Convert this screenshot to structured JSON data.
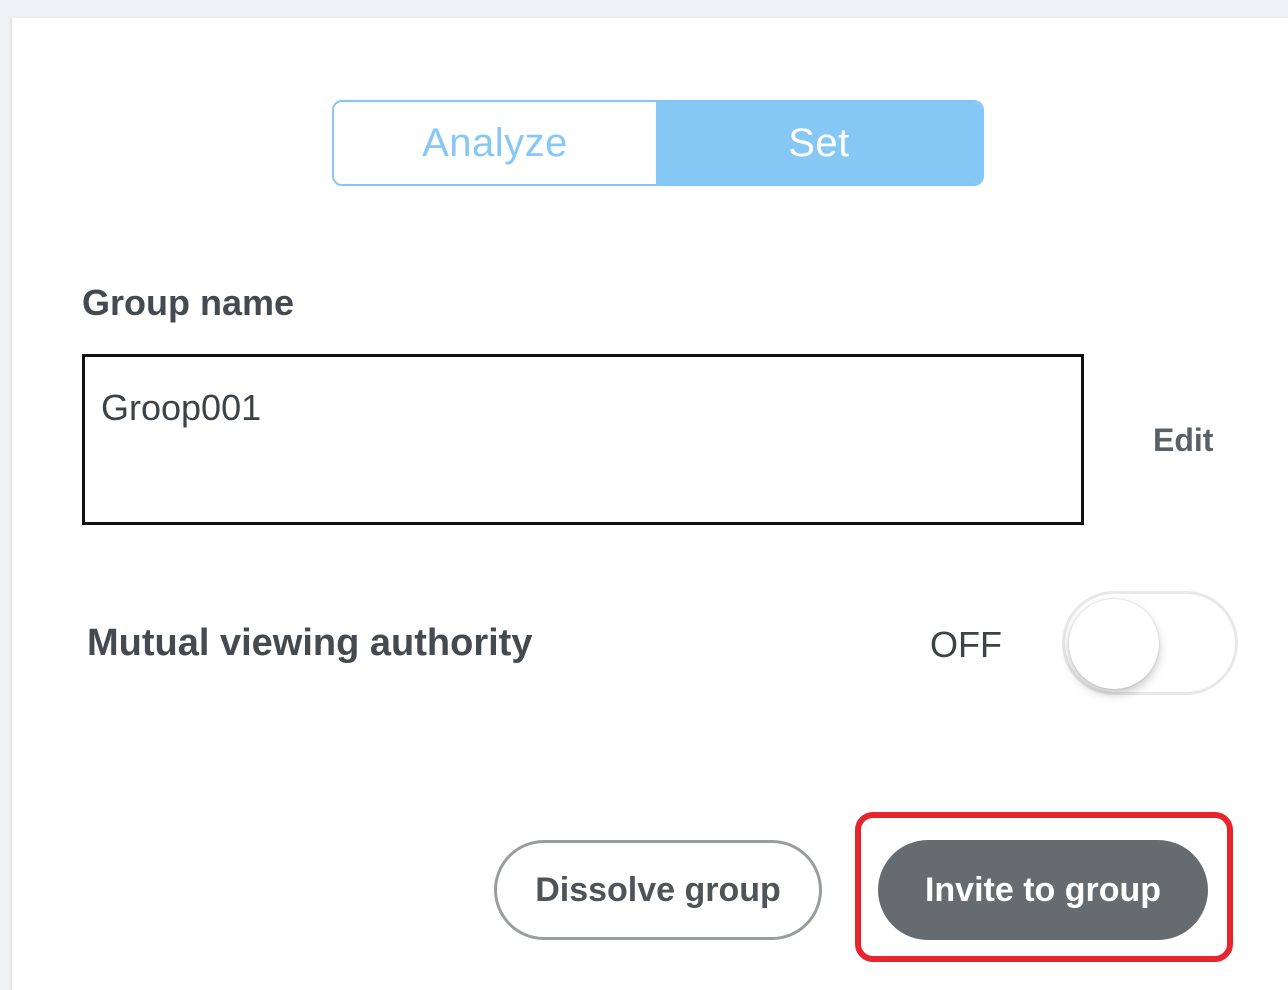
{
  "tabs": {
    "analyze_label": "Analyze",
    "set_label": "Set",
    "active": "Set"
  },
  "group_name": {
    "label": "Group name",
    "value": "Groop001",
    "edit_label": "Edit"
  },
  "mutual_viewing": {
    "label": "Mutual viewing authority",
    "state_label": "OFF",
    "enabled": false
  },
  "actions": {
    "dissolve_label": "Dissolve group",
    "invite_label": "Invite to group"
  },
  "colors": {
    "accent": "#86c8f5",
    "primary_button": "#666b70",
    "highlight": "#e8242c"
  }
}
